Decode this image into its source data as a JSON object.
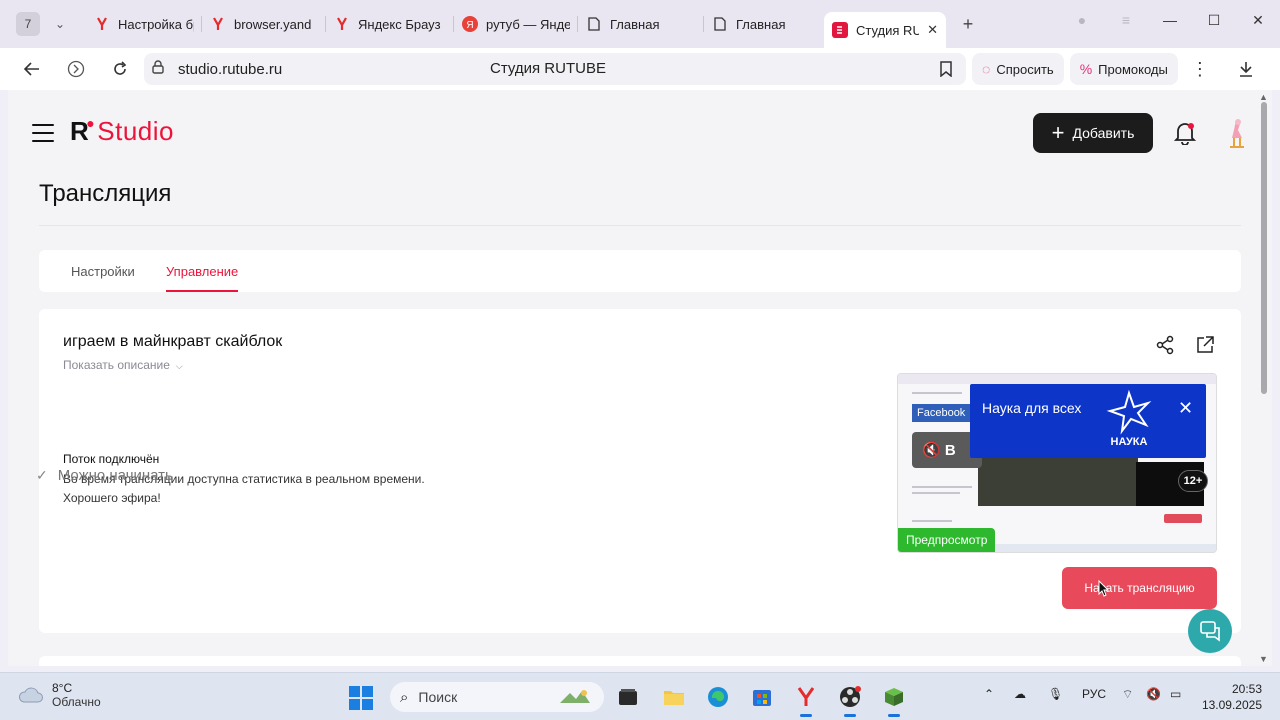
{
  "browser": {
    "tab_count": "7",
    "tabs": [
      {
        "title": "Настройка бр",
        "favicon": "yandex-y"
      },
      {
        "title": "browser.yand",
        "favicon": "yandex-y"
      },
      {
        "title": "Яндекс Брауз",
        "favicon": "yandex-y"
      },
      {
        "title": "рутуб — Янде",
        "favicon": "yandex-red-circle"
      },
      {
        "title": "Главная",
        "favicon": "document"
      },
      {
        "title": "Главная",
        "favicon": "document"
      },
      {
        "title": "Студия RU",
        "favicon": "rutube-studio",
        "active": true
      }
    ],
    "url": "studio.rutube.ru",
    "page_title": "Студия RUTUBE",
    "ask_label": "Спросить",
    "promo_label": "Промокоды",
    "colors": {
      "accent_pink": "#e0337a"
    }
  },
  "app": {
    "logo_r": "R",
    "logo_studio": "Studio",
    "add_label": "Добавить",
    "page_title": "Трансляция",
    "tabs": {
      "settings": "Настройки",
      "control": "Управление"
    },
    "colors": {
      "brand_red": "#ed143b",
      "start_button": "#e84a5b",
      "preview_badge": "#2eb82e",
      "support": "#2ea9ab"
    }
  },
  "stream": {
    "title": "играем в майнкравт скайблок",
    "show_description": "Показать описание",
    "status_head": "Поток подключён",
    "status_line1": "Во время трансляции доступна статистика в реальном времени.",
    "status_line2": "Хорошего эфира!",
    "ready_label": "Можно начинать",
    "start_label": "Начать трансляцию",
    "preview_label": "Предпросмотр",
    "preview": {
      "facebook": "Facebook",
      "mute_text": "В",
      "ad_title": "Наука для всех",
      "ad_logo": "НАУКА",
      "age_rating": "12+"
    }
  },
  "taskbar": {
    "temperature": "8°C",
    "weather": "Облачно",
    "search_placeholder": "Поиск",
    "language": "РУС",
    "time": "20:53",
    "date": "13.09.2025"
  }
}
